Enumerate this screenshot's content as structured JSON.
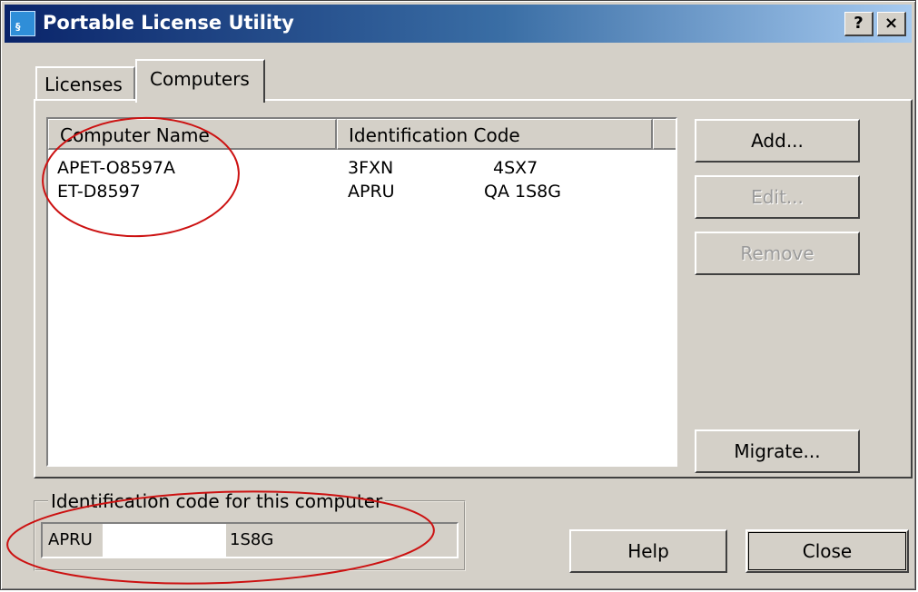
{
  "window": {
    "title": "Portable License Utility"
  },
  "titlebar_buttons": {
    "help": "?",
    "close": "×"
  },
  "tabs": [
    {
      "label": "Licenses",
      "active": false
    },
    {
      "label": "Computers",
      "active": true
    }
  ],
  "list": {
    "columns": [
      "Computer Name",
      "Identification Code"
    ],
    "rows": [
      {
        "name": "APET-O8597A",
        "code_a": "3FXN",
        "code_b": "4SX7"
      },
      {
        "name": "ET-D8597",
        "code_a": "APRU",
        "code_b": "QA 1S8G"
      }
    ]
  },
  "buttons": {
    "add": "Add...",
    "edit": "Edit...",
    "remove": "Remove",
    "migrate": "Migrate...",
    "help": "Help",
    "close": "Close"
  },
  "this_computer": {
    "label": "Identification code for this computer",
    "code_start": "APRU",
    "code_end": "1S8G"
  },
  "colors": {
    "annotation": "#cc1111",
    "titlebar_start": "#0a246a",
    "titlebar_end": "#a6caf0"
  }
}
